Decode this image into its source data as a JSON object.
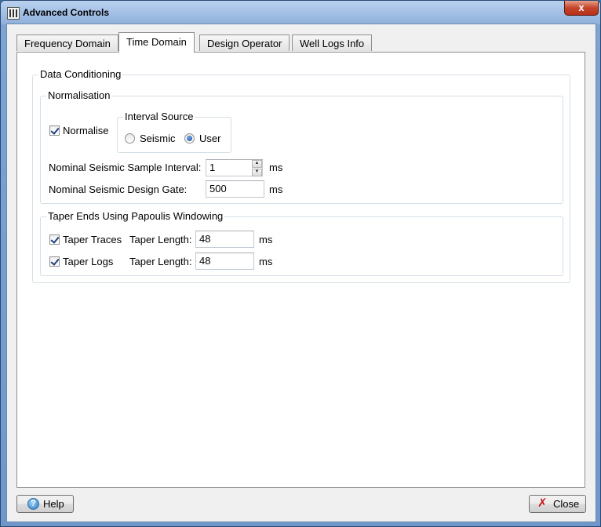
{
  "window": {
    "title": "Advanced Controls",
    "close_glyph": "x"
  },
  "tabs": [
    {
      "label": "Frequency Domain",
      "active": false
    },
    {
      "label": "Time Domain",
      "active": true
    },
    {
      "label": "Design Operator",
      "active": false
    },
    {
      "label": "Well Logs Info",
      "active": false
    }
  ],
  "data_conditioning": {
    "title": "Data Conditioning",
    "normalisation": {
      "title": "Normalisation",
      "normalise_label": "Normalise",
      "normalise_checked": true,
      "interval_source": {
        "title": "Interval Source",
        "options": [
          "Seismic",
          "User"
        ],
        "selected": "User"
      },
      "sample_interval_label": "Nominal Seismic Sample Interval:",
      "sample_interval_value": "1",
      "design_gate_label": "Nominal Seismic Design Gate:",
      "design_gate_value": "500",
      "unit": "ms"
    },
    "taper": {
      "title": "Taper Ends Using Papoulis Windowing",
      "traces_label": "Taper Traces",
      "traces_checked": true,
      "logs_label": "Taper Logs",
      "logs_checked": true,
      "length_label": "Taper Length:",
      "traces_length": "48",
      "logs_length": "48",
      "unit": "ms"
    }
  },
  "footer": {
    "help_label": "Help",
    "close_label": "Close"
  },
  "icons": {
    "app": "equalizer-icon",
    "help": "help-icon",
    "close": "close-x-icon"
  },
  "colors": {
    "title_gradient": "#8fb0db",
    "close_red": "#c4452a",
    "panel_bg": "#ffffff"
  }
}
